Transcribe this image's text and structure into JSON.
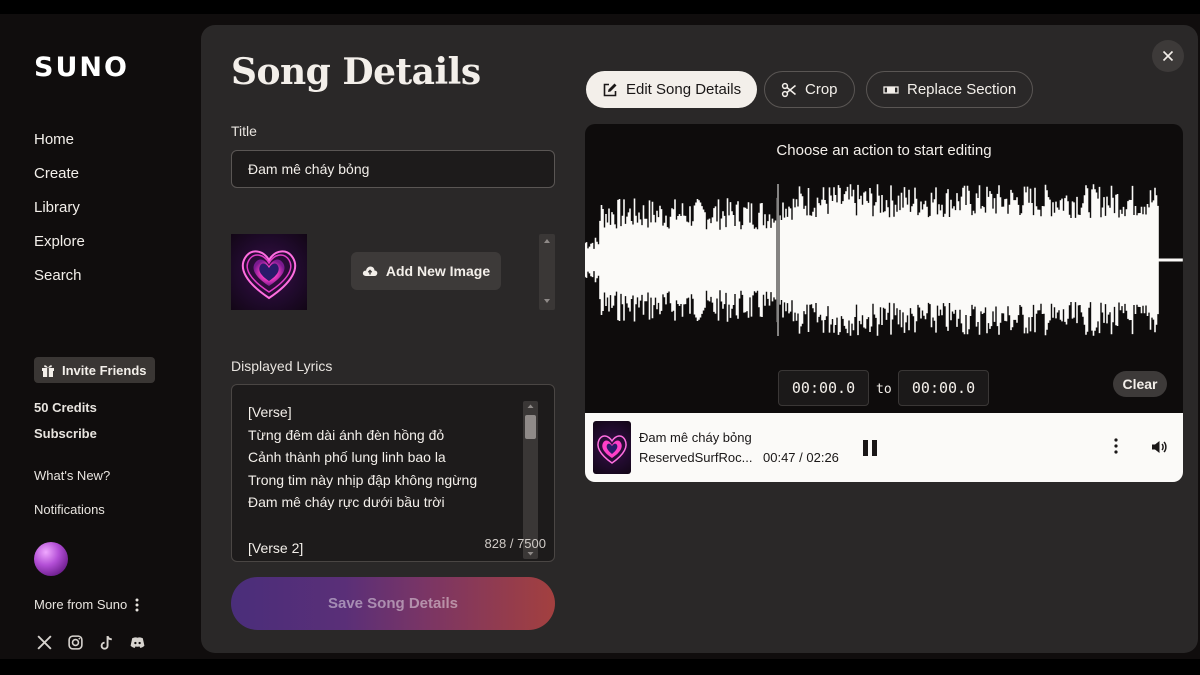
{
  "sidebar": {
    "logo": "SUNO",
    "nav": [
      "Home",
      "Create",
      "Library",
      "Explore",
      "Search"
    ],
    "invite_label": "Invite Friends",
    "credits": "50 Credits",
    "subscribe": "Subscribe",
    "whats_new": "What's New?",
    "notifications": "Notifications",
    "more_from": "More from Suno",
    "social_icons": [
      "x-icon",
      "instagram-icon",
      "tiktok-icon",
      "discord-icon"
    ]
  },
  "form": {
    "page_title": "Song Details",
    "title_label": "Title",
    "title_value": "Đam mê cháy bỏng",
    "add_image_label": "Add New Image",
    "lyrics_label": "Displayed Lyrics",
    "lyrics": "[Verse]\nTừng đêm dài ánh đèn hồng đỏ\nCảnh thành phố lung linh bao la\nTrong tim này nhịp đập không ngừng\nĐam mê cháy rực dưới bầu trời\n\n[Verse 2]",
    "char_count": "828 / 7500",
    "save_label": "Save Song Details"
  },
  "toolbar": {
    "edit_label": "Edit Song Details",
    "crop_label": "Crop",
    "replace_label": "Replace Section"
  },
  "editor": {
    "hint": "Choose an action to start editing",
    "start_time": "00:00.0",
    "to_label": "to",
    "end_time": "00:00.0",
    "clear_label": "Clear"
  },
  "player": {
    "title": "Đam mê cháy bỏng",
    "artist": "ReservedSurfRoc...",
    "time": "00:47 / 02:26"
  },
  "colors": {
    "background": "#100d0d",
    "panel": "#2a2828",
    "accent_light": "#f3efea",
    "heart_pink": "#ff4fd0"
  }
}
